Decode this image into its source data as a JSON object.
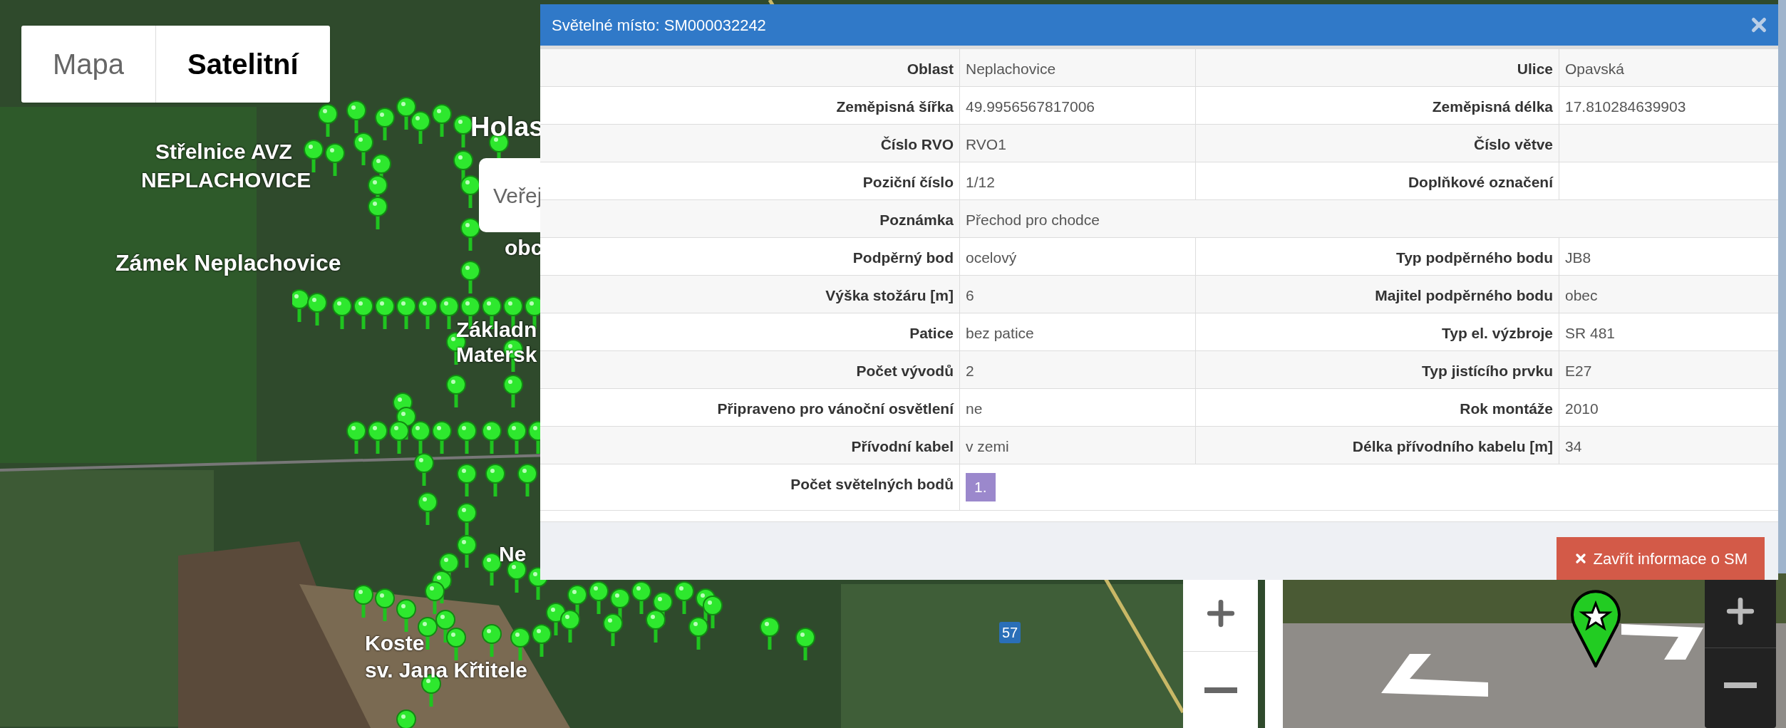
{
  "map": {
    "type_toggle": [
      {
        "label": "Mapa",
        "selected": false
      },
      {
        "label": "Satelitní",
        "selected": true
      }
    ],
    "labels": [
      "Holas",
      "Střelnice AVZ",
      "NEPLACHOVICE",
      "Zámek Neplachovice",
      "obc",
      "Základn",
      "Matersk",
      "Ne",
      "Koste",
      "sv. Jana Křtitele"
    ],
    "place_card": "Veřej",
    "road_badge": "57"
  },
  "dialog": {
    "title": "Světelné místo: SM000032242",
    "rows": [
      {
        "kind": "pair",
        "label": "Oblast",
        "value": "Neplachovice",
        "label_2": "Ulice",
        "value_2": "Opavská"
      },
      {
        "kind": "pair",
        "label": "Zeměpisná šířka",
        "value": "49.9956567817006",
        "label_2": "Zeměpisná délka",
        "value_2": "17.810284639903"
      },
      {
        "kind": "pair",
        "label": "Číslo RVO",
        "value": "RVO1",
        "label_2": "Číslo větve"
      },
      {
        "kind": "pair",
        "label": "Poziční číslo",
        "value": "1/12",
        "label_2": "Doplňkové označení"
      },
      {
        "kind": "wide",
        "label": "Poznámka",
        "value": "Přechod pro chodce"
      },
      {
        "kind": "pair",
        "label": "Podpěrný bod",
        "value": "ocelový",
        "label_2": "Typ podpěrného bodu",
        "value_2": "JB8"
      },
      {
        "kind": "pair",
        "label": "Výška stožáru [m]",
        "value": "6",
        "label_2": "Majitel podpěrného bodu",
        "value_2": "obec"
      },
      {
        "kind": "pair",
        "label": "Patice",
        "value": "bez patice",
        "label_2": "Typ el. výzbroje",
        "value_2": "SR 481"
      },
      {
        "kind": "pair",
        "label": "Počet vývodů",
        "value": "2",
        "label_2": "Typ jistícího prvku",
        "value_2": "E27"
      },
      {
        "kind": "pair",
        "label": "Připraveno pro vánoční osvětlení",
        "value": "ne",
        "label_2": "Rok montáže",
        "value_2": "2010"
      },
      {
        "kind": "pair",
        "label": "Přívodní kabel",
        "value": "v zemi",
        "label_2": "Délka přívodního kabelu [m]",
        "value_2": "34"
      },
      {
        "kind": "badges",
        "label": "Počet světelných bodů",
        "badges": [
          "1."
        ]
      }
    ],
    "close_button": "Zavřít informace o SM"
  }
}
